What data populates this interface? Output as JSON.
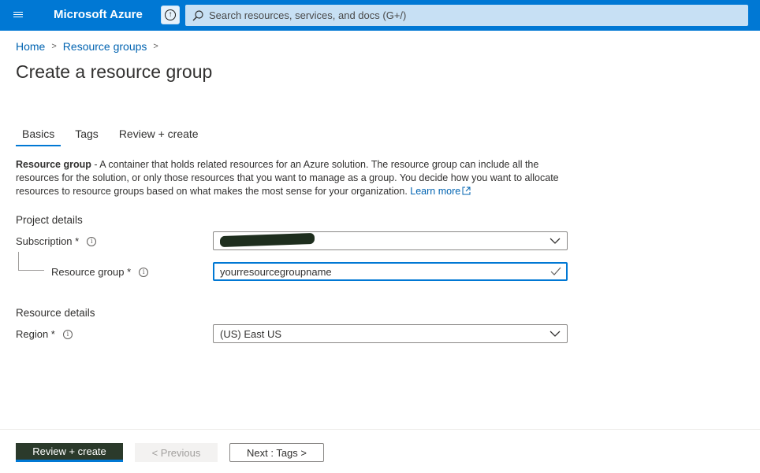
{
  "topbar": {
    "brand": "Microsoft Azure",
    "search_placeholder": "Search resources, services, and docs (G+/)",
    "accent": "#0078d4",
    "search_bg": "#c7e0f4",
    "menu_icon": "hamburger-icon",
    "upgrade_icon": "upload-circle-icon",
    "search_icon": "search-icon"
  },
  "breadcrumb": {
    "items": [
      "Home",
      "Resource groups"
    ]
  },
  "page": {
    "title": "Create a resource group"
  },
  "tabs": [
    {
      "label": "Basics",
      "active": true
    },
    {
      "label": "Tags",
      "active": false
    },
    {
      "label": "Review + create",
      "active": false
    }
  ],
  "description": {
    "lead": "Resource group",
    "text": " - A container that holds related resources for an Azure solution. The resource group can include all the resources for the solution, or only those resources that you want to manage as a group. You decide how you want to allocate resources to resource groups based on what makes the most sense for your organization. ",
    "link": "Learn more"
  },
  "project_details": {
    "heading": "Project details",
    "subscription": {
      "label": "Subscription *",
      "value": ""
    },
    "resource_group": {
      "label": "Resource group *",
      "value": "yourresourcegroupname"
    }
  },
  "resource_details": {
    "heading": "Resource details",
    "region": {
      "label": "Region *",
      "value": "(US) East US"
    }
  },
  "footer": {
    "review_create": "Review + create",
    "previous": "< Previous",
    "next": "Next : Tags >"
  }
}
